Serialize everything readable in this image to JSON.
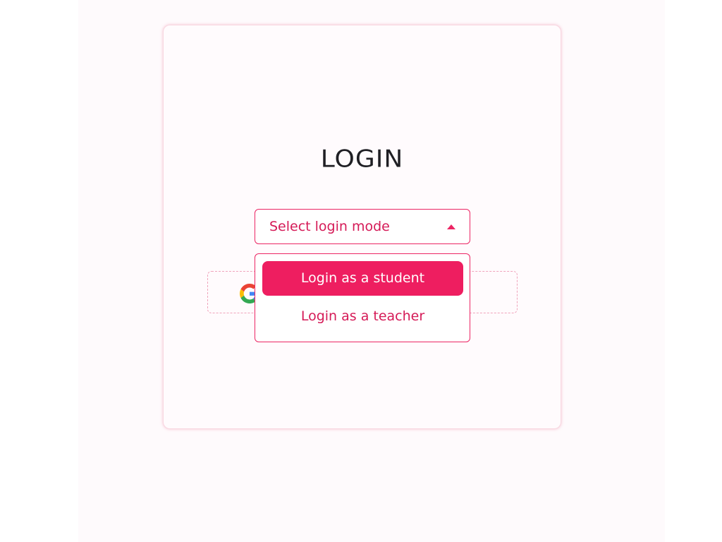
{
  "login": {
    "title": "LOGIN",
    "mode_select": {
      "placeholder": "Select login mode",
      "expanded": true,
      "caret_icon": "caret-up-icon"
    },
    "options": [
      {
        "label": "Login as a student",
        "highlighted": true
      },
      {
        "label": "Login as a teacher",
        "highlighted": false
      }
    ],
    "google_button": {
      "icon": "google-icon"
    }
  },
  "colors": {
    "accent": "#ec2564",
    "accent_text": "#d51a57",
    "card_background": "#fffbfd",
    "page_background": "#fefafc",
    "title_text": "#1f1f24"
  }
}
